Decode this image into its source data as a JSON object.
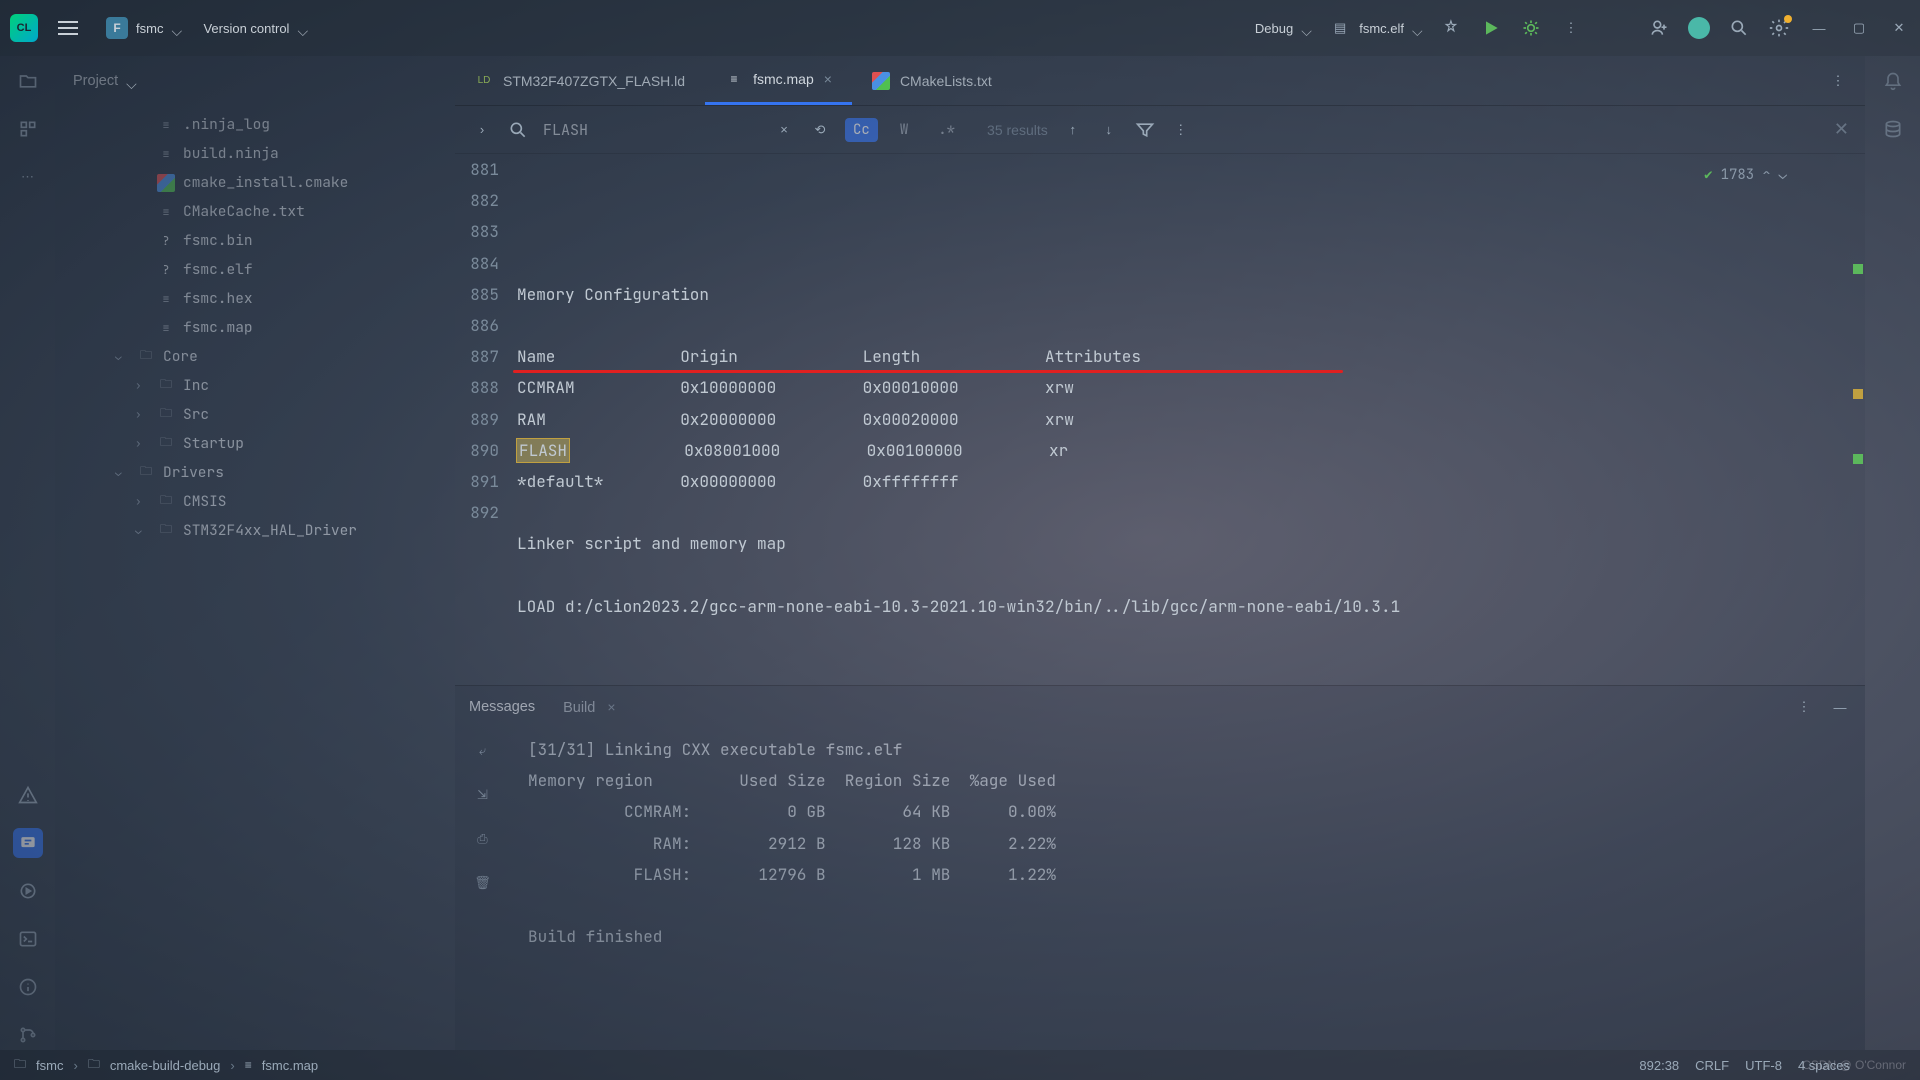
{
  "titlebar": {
    "project_name": "fsmc",
    "version_control": "Version control",
    "debug_label": "Debug",
    "run_target": "fsmc.elf"
  },
  "project_panel": {
    "title": "Project",
    "tree": [
      {
        "indent": 3,
        "type": "file",
        "icon": "txt",
        "name": ".ninja_log"
      },
      {
        "indent": 3,
        "type": "file",
        "icon": "txt",
        "name": "build.ninja"
      },
      {
        "indent": 3,
        "type": "file",
        "icon": "cmake",
        "name": "cmake_install.cmake"
      },
      {
        "indent": 3,
        "type": "file",
        "icon": "txt",
        "name": "CMakeCache.txt"
      },
      {
        "indent": 3,
        "type": "file",
        "icon": "bin",
        "name": "fsmc.bin"
      },
      {
        "indent": 3,
        "type": "file",
        "icon": "bin",
        "name": "fsmc.elf"
      },
      {
        "indent": 3,
        "type": "file",
        "icon": "txt",
        "name": "fsmc.hex"
      },
      {
        "indent": 3,
        "type": "file",
        "icon": "txt",
        "name": "fsmc.map"
      },
      {
        "indent": 2,
        "type": "folder",
        "expanded": true,
        "name": "Core"
      },
      {
        "indent": 3,
        "type": "folder",
        "expanded": false,
        "name": "Inc"
      },
      {
        "indent": 3,
        "type": "folder",
        "expanded": false,
        "name": "Src"
      },
      {
        "indent": 3,
        "type": "folder",
        "expanded": false,
        "name": "Startup"
      },
      {
        "indent": 2,
        "type": "folder",
        "expanded": true,
        "name": "Drivers"
      },
      {
        "indent": 3,
        "type": "folder",
        "expanded": false,
        "name": "CMSIS"
      },
      {
        "indent": 3,
        "type": "folder",
        "expanded": true,
        "name": "STM32F4xx_HAL_Driver"
      }
    ]
  },
  "tabs": [
    {
      "icon": "ld",
      "label": "STM32F407ZGTX_FLASH.ld",
      "active": false,
      "closeable": false
    },
    {
      "icon": "map",
      "label": "fsmc.map",
      "active": true,
      "closeable": true
    },
    {
      "icon": "cmake",
      "label": "CMakeLists.txt",
      "active": false,
      "closeable": false
    }
  ],
  "search": {
    "query": "FLASH",
    "results": "35 results",
    "case_active": true,
    "cc_label": "Cc",
    "w_label": "W",
    "re_label": ".*"
  },
  "code_badge": {
    "count": "1783"
  },
  "editor": {
    "first_line": 881,
    "lines": [
      "",
      "Memory Configuration",
      "",
      "Name             Origin             Length             Attributes",
      "CCMRAM           0x10000000         0x00010000         xrw",
      "RAM              0x20000000         0x00020000         xrw",
      "FLASH            0x08001000         0x00100000         xr",
      "*default*        0x00000000         0xffffffff",
      "",
      "Linker script and memory map",
      "",
      "LOAD d:/clion2023.2/gcc-arm-none-eabi-10.3-2021.10-win32/bin/../lib/gcc/arm-none-eabi/10.3.1"
    ],
    "highlight_line_index": 6,
    "highlight_token": "FLASH"
  },
  "bottom": {
    "tabs": {
      "messages": "Messages",
      "build": "Build"
    },
    "content": "[31/31] Linking CXX executable fsmc.elf\nMemory region         Used Size  Region Size  %age Used\n          CCMRAM:          0 GB        64 KB      0.00%\n             RAM:        2912 B       128 KB      2.22%\n           FLASH:       12796 B         1 MB      1.22%\n\nBuild finished"
  },
  "statusbar": {
    "crumbs": [
      "fsmc",
      "cmake-build-debug",
      "fsmc.map"
    ],
    "position": "892:38",
    "line_sep": "CRLF",
    "encoding": "UTF-8",
    "indent": "4 spaces",
    "watermark": "CSDN @ O'Connor"
  }
}
